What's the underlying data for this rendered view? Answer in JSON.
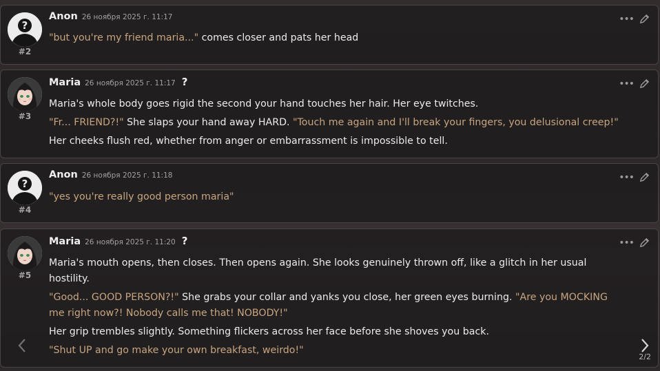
{
  "messages": [
    {
      "name": "Anon",
      "date": "26 ноября 2025 г. 11:17",
      "id": "#2",
      "avatar": "user-silhouette",
      "lines": [
        [
          {
            "t": "q",
            "text": "\"but you're my friend maria...\""
          },
          {
            "t": "n",
            "text": " comes closer and pats her head"
          }
        ]
      ]
    },
    {
      "name": "Maria",
      "date": "26 ноября 2025 г. 11:17",
      "id": "#3",
      "avatar": "maria-portrait",
      "badge": "?",
      "lines": [
        [
          {
            "t": "n",
            "text": "Maria's whole body goes rigid the second your hand touches her hair. Her eye twitches."
          }
        ],
        [
          {
            "t": "q",
            "text": "\"Fr... FRIEND?!\""
          },
          {
            "t": "n",
            "text": " She slaps your hand away HARD. "
          },
          {
            "t": "q",
            "text": "\"Touch me again and I'll break your fingers, you delusional creep!\""
          }
        ],
        [
          {
            "t": "n",
            "text": "Her cheeks flush red, whether from anger or embarrassment is impossible to tell."
          }
        ]
      ]
    },
    {
      "name": "Anon",
      "date": "26 ноября 2025 г. 11:18",
      "id": "#4",
      "avatar": "user-silhouette",
      "lines": [
        [
          {
            "t": "q",
            "text": "\"yes you're really good person maria\""
          }
        ]
      ]
    },
    {
      "name": "Maria",
      "date": "26 ноября 2025 г. 11:20",
      "id": "#5",
      "avatar": "maria-portrait",
      "badge": "?",
      "lines": [
        [
          {
            "t": "n",
            "text": "Maria's mouth opens, then closes. Then opens again. She looks genuinely thrown off, like a glitch in her usual hostility."
          }
        ],
        [
          {
            "t": "q",
            "text": "\"Good... GOOD PERSON?!\""
          },
          {
            "t": "n",
            "text": " She grabs your collar and yanks you close, her green eyes burning. "
          },
          {
            "t": "q",
            "text": "\"Are you MOCKING me right now?! Nobody calls me that! NOBODY!\""
          }
        ],
        [
          {
            "t": "n",
            "text": "Her grip trembles slightly. Something flickers across her face before she shoves you back."
          }
        ],
        [
          {
            "t": "q",
            "text": "\"Shut UP and go make your own breakfast, weirdo!\""
          }
        ]
      ],
      "swipe": "2/2"
    }
  ],
  "icons": {
    "menu": "ellipsis-icon",
    "edit": "pencil-icon",
    "swipe_left": "chevron-left-icon",
    "swipe_right": "chevron-right-icon"
  },
  "colors": {
    "quote": "#c8a57f",
    "text": "#ececec"
  }
}
